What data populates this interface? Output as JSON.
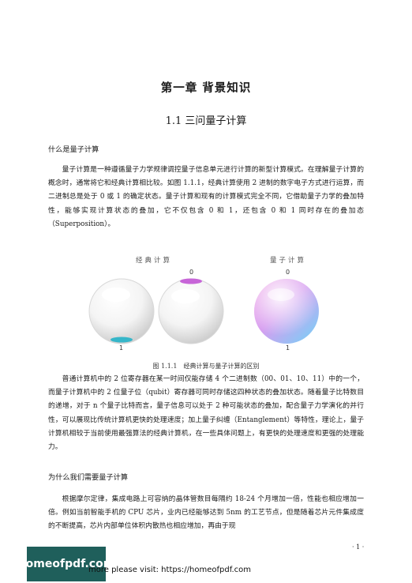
{
  "chapter_title": "第一章 背景知识",
  "section_title": "1.1 三问量子计算",
  "sub1": "什么是量子计算",
  "para1": "量子计算是一种遵循量子力学规律调控量子信息单元进行计算的新型计算模式。在理解量子计算的概念时，通常将它和经典计算相比较。如图 1.1.1，经典计算使用 2 进制的数字电子方式进行运算，而二进制总是处于 0 或 1 的确定状态。量子计算和现有的计算模式完全不同，它借助量子力学的叠加特性，能够实现计算状态的叠加，它不仅包含 0 和 1，还包含 0 和 1 同时存在的叠加态（Superposition）。",
  "figure": {
    "classical_title": "经典计算",
    "quantum_title": "量子计算",
    "labels": {
      "classical_left_bottom": "1",
      "classical_right_top": "0",
      "quantum_top": "0",
      "quantum_bottom": "1"
    },
    "colors": {
      "classical_one_marker": "#36b6c9",
      "classical_zero_marker": "#c765d8",
      "quantum_pink": "#e48de6",
      "quantum_blue": "#7ad3f5"
    }
  },
  "caption": "图 1.1.1　经典计算与量子计算的区别",
  "para2": "普通计算机中的 2 位寄存器在某一时间仅能存储 4 个二进制数（00、01、10、11）中的一个，而量子计算机中的 2 位量子位（qubit）寄存器可同时存储这四种状态的叠加状态。随着量子比特数目的递增，对于 n 个量子比特而言，量子信息可以处于 2 种可能状态的叠加，配合量子力学演化的并行性，可以展现比传统计算机更快的处理速度；加上量子纠缠（Entanglement）等特性，理论上，量子计算机相较于当前使用最强算法的经典计算机，在一些具体问题上，有更快的处理速度和更强的处理能力。",
  "sub2": "为什么我们需要量子计算",
  "para3": "根据摩尔定律，集成电路上可容纳的晶体管数目每隔约 18-24 个月增加一倍，性能也相应增加一倍。例如当前智能手机的 CPU 芯片，业内已经能够达到 5nm 的工艺节点，但是随着芯片元件集成度的不断提高，芯片内部单位体积内散热也相应增加，再由于现",
  "page_number": "· 1 ·",
  "watermark_logo": "homeofpdf.com",
  "footer_text": "more please visit: https://homeofpdf.com"
}
